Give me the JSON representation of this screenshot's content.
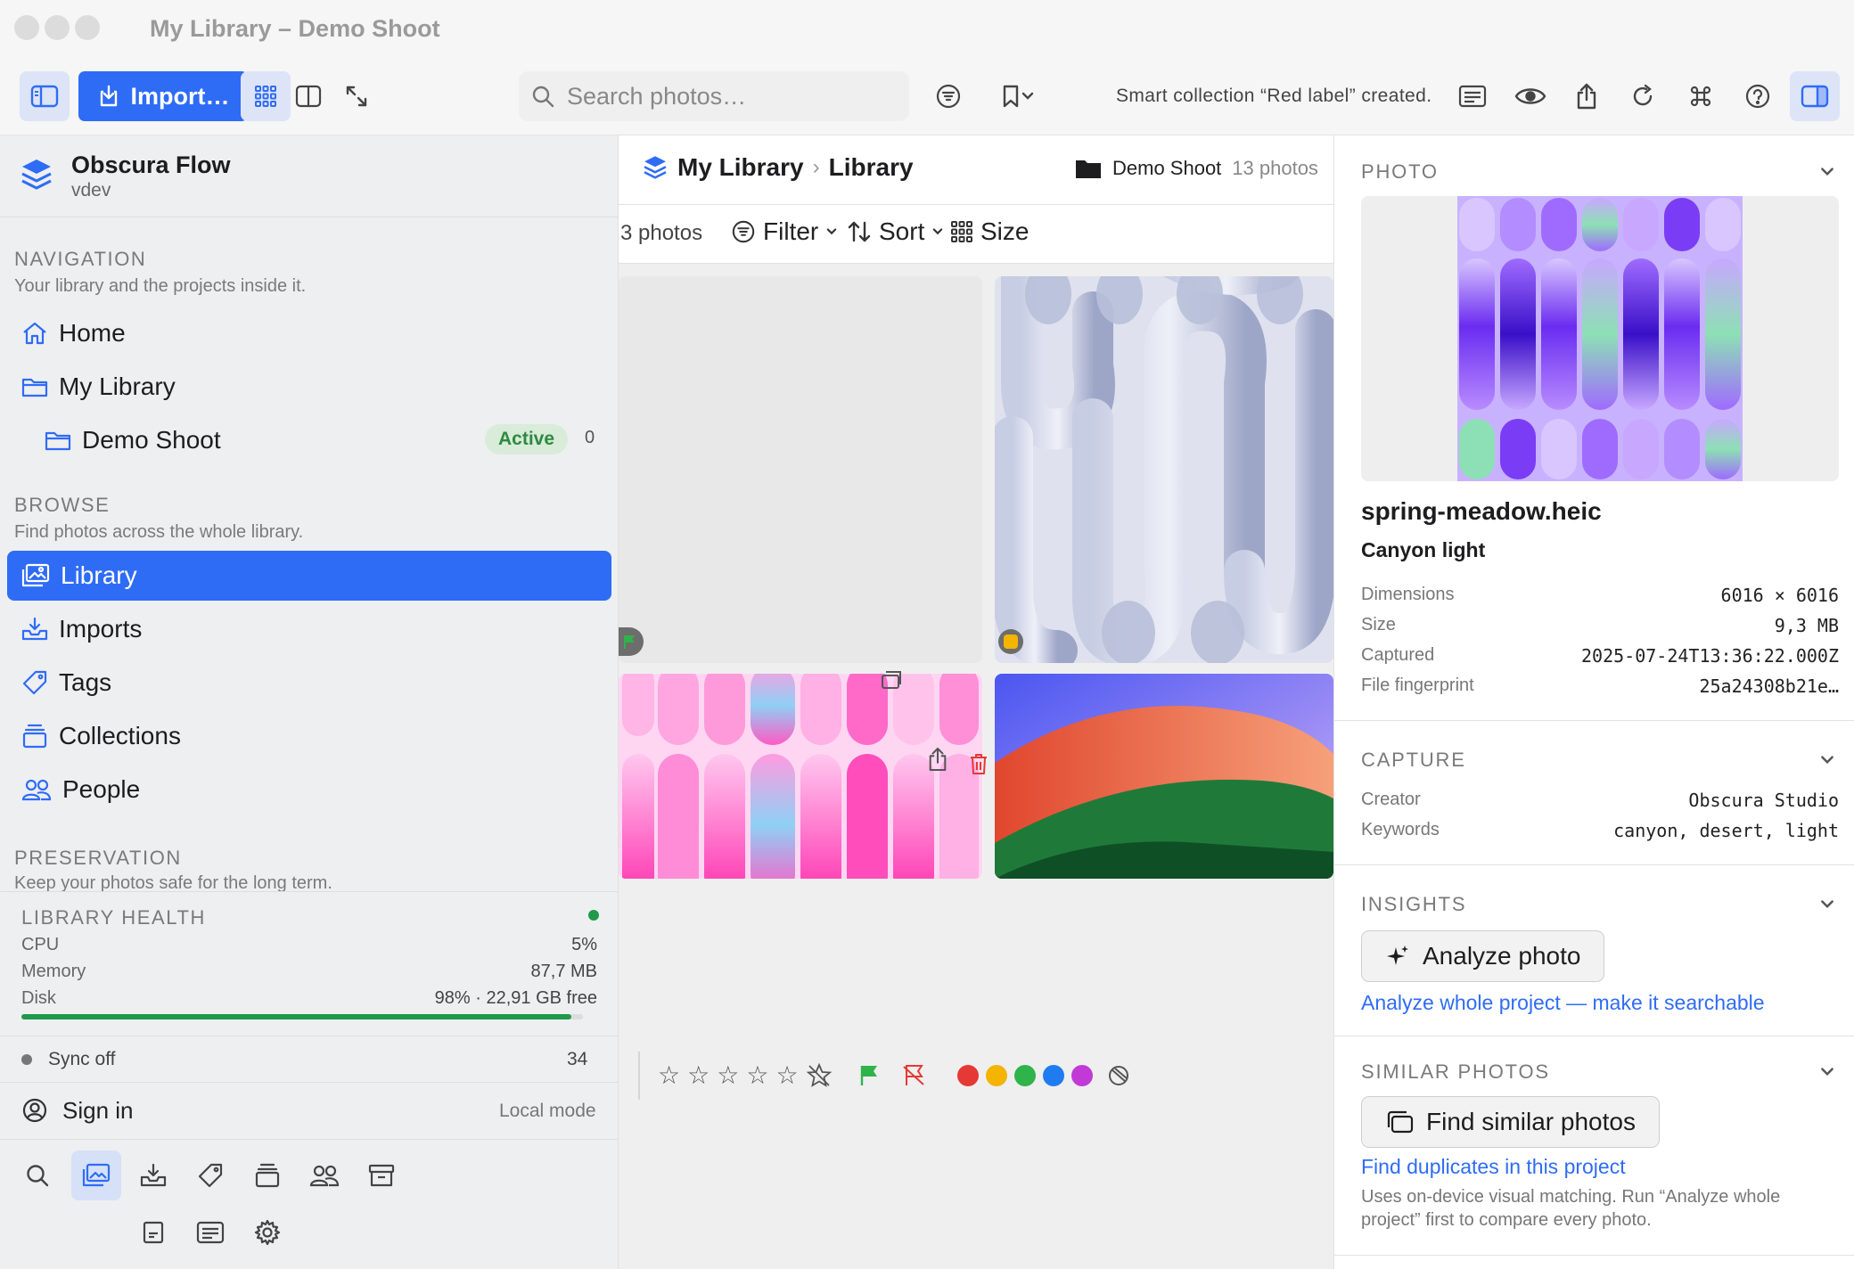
{
  "window": {
    "title": "My Library – Demo Shoot"
  },
  "toolbar": {
    "import_label": "Import…",
    "search_placeholder": "Search photos…",
    "status_message": "Smart collection “Red label” created."
  },
  "sidebar": {
    "app_name": "Obscura Flow",
    "app_version": "vdev",
    "navigation": {
      "title": "NAVIGATION",
      "subtitle": "Your library and the projects inside it.",
      "items": [
        {
          "label": "Home",
          "icon": "home-icon"
        },
        {
          "label": "My Library",
          "icon": "folder-icon"
        },
        {
          "label": "Demo Shoot",
          "icon": "folder-icon",
          "badge": "Active",
          "count": "0"
        }
      ]
    },
    "browse": {
      "title": "BROWSE",
      "subtitle": "Find photos across the whole library.",
      "items": [
        {
          "label": "Library",
          "icon": "photos-icon",
          "selected": true
        },
        {
          "label": "Imports",
          "icon": "import-tray-icon"
        },
        {
          "label": "Tags",
          "icon": "tag-icon"
        },
        {
          "label": "Collections",
          "icon": "collections-icon"
        },
        {
          "label": "People",
          "icon": "people-icon"
        }
      ]
    },
    "preservation": {
      "title": "PRESERVATION",
      "subtitle": "Keep your photos safe for the long term."
    },
    "health": {
      "title": "LIBRARY HEALTH",
      "status_color": "#1f9a4a",
      "cpu_label": "CPU",
      "cpu_value": "5%",
      "memory_label": "Memory",
      "memory_value": "87,7 MB",
      "disk_label": "Disk",
      "disk_value": "98% · 22,91 GB free",
      "disk_fill_fraction": 0.98
    },
    "sync": {
      "label": "Sync off",
      "count": "34"
    },
    "account": {
      "label": "Sign in",
      "mode": "Local mode"
    }
  },
  "main": {
    "breadcrumb": {
      "root": "My Library",
      "current": "Library"
    },
    "project": {
      "name": "Demo Shoot",
      "count": "13 photos"
    },
    "photo_count": "3 photos",
    "filter_label": "Filter",
    "sort_label": "Sort",
    "size_label": "Size",
    "rating": {
      "stars": 5
    },
    "color_labels": [
      "#e53935",
      "#f4b400",
      "#2fb34a",
      "#1e7cf0",
      "#c13ad8"
    ]
  },
  "inspector": {
    "photo": {
      "section_title": "PHOTO",
      "filename": "spring-meadow.heic",
      "title": "Canyon light",
      "fields": [
        {
          "key": "Dimensions",
          "value": "6016 × 6016"
        },
        {
          "key": "Size",
          "value": "9,3 MB"
        },
        {
          "key": "Captured",
          "value": "2025-07-24T13:36:22.000Z"
        },
        {
          "key": "File fingerprint",
          "value": "25a24308b21e…"
        }
      ]
    },
    "capture": {
      "section_title": "CAPTURE",
      "fields": [
        {
          "key": "Creator",
          "value": "Obscura Studio"
        },
        {
          "key": "Keywords",
          "value": "canyon, desert, light"
        }
      ]
    },
    "insights": {
      "section_title": "INSIGHTS",
      "analyze_label": "Analyze photo",
      "analyze_project_link": "Analyze whole project — make it searchable"
    },
    "similar": {
      "section_title": "SIMILAR PHOTOS",
      "find_label": "Find similar photos",
      "duplicates_link": "Find duplicates in this project",
      "note": "Uses on-device visual matching. Run “Analyze whole project” first to compare every photo."
    }
  },
  "colors": {
    "accent": "#2f6cf5",
    "active_badge_bg": "#d8ecd9",
    "active_badge_fg": "#2e8a3e"
  }
}
